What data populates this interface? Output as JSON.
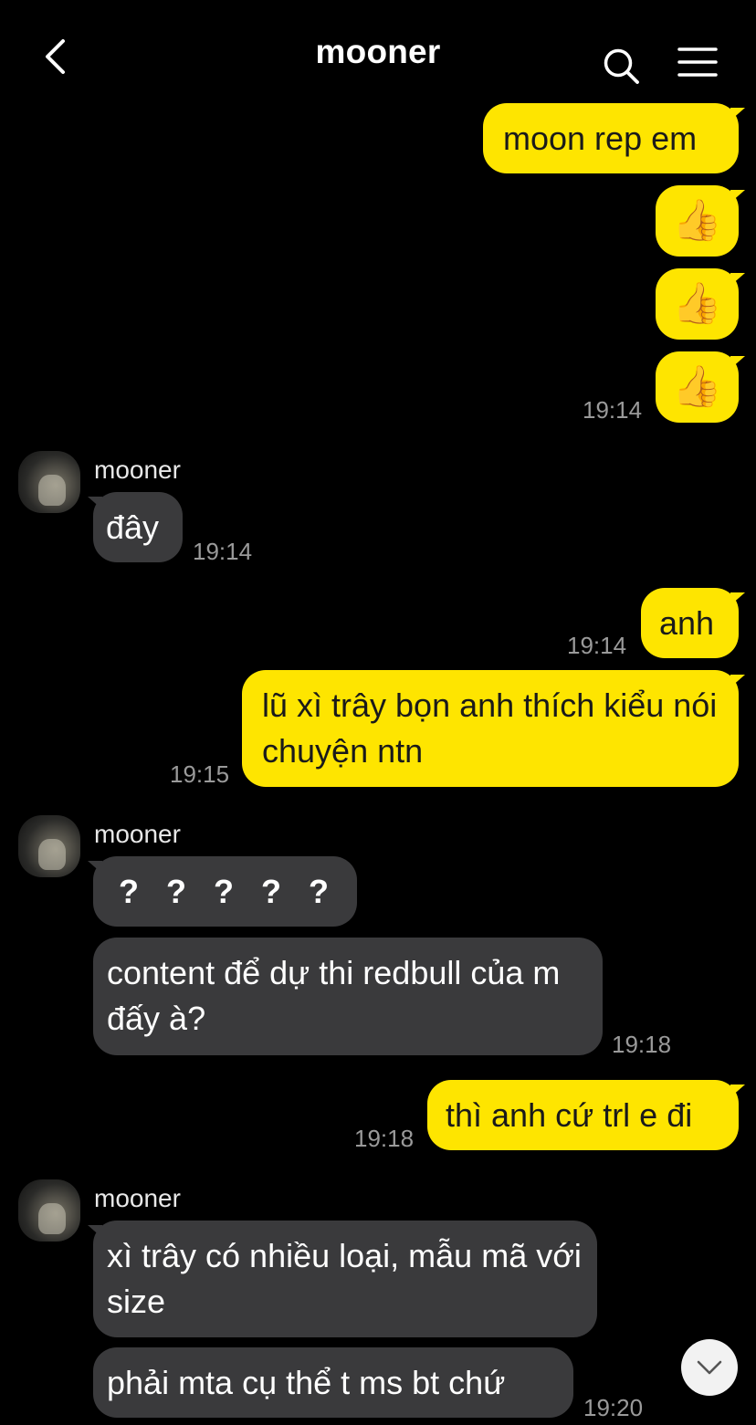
{
  "header": {
    "title": "mooner",
    "back_icon": "chevron-left-icon",
    "search_icon": "search-icon",
    "menu_icon": "hamburger-menu-icon"
  },
  "colors": {
    "background": "#000000",
    "my_bubble": "#FEE500",
    "their_bubble": "#3a3a3c",
    "timestamp": "#9a9a9a"
  },
  "messages": [
    {
      "from": "me",
      "text": "moon rep em"
    },
    {
      "from": "me",
      "text": "👍",
      "type": "emoji"
    },
    {
      "from": "me",
      "text": "👍",
      "type": "emoji"
    },
    {
      "from": "me",
      "text": "👍",
      "type": "emoji",
      "time": "19:14"
    },
    {
      "from": "mooner",
      "sender": "mooner",
      "text": "đây",
      "time": "19:14"
    },
    {
      "from": "me",
      "text": "anh",
      "time": "19:14"
    },
    {
      "from": "me",
      "text": "lũ xì trây bọn anh thích kiểu nói chuyện ntn",
      "time": "19:15"
    },
    {
      "from": "mooner",
      "sender": "mooner",
      "text": "? ? ? ? ?"
    },
    {
      "from": "mooner",
      "text": "content để dự thi redbull của m đấy à?",
      "time": "19:18"
    },
    {
      "from": "me",
      "text": "thì anh cứ trl e đi",
      "time": "19:18"
    },
    {
      "from": "mooner",
      "sender": "mooner",
      "text": "xì trây có nhiều loại, mẫu mã với size"
    },
    {
      "from": "mooner",
      "text": "phải mta cụ thể t ms bt chứ",
      "time": "19:20"
    }
  ],
  "scroll_down_icon": "chevron-down-icon"
}
